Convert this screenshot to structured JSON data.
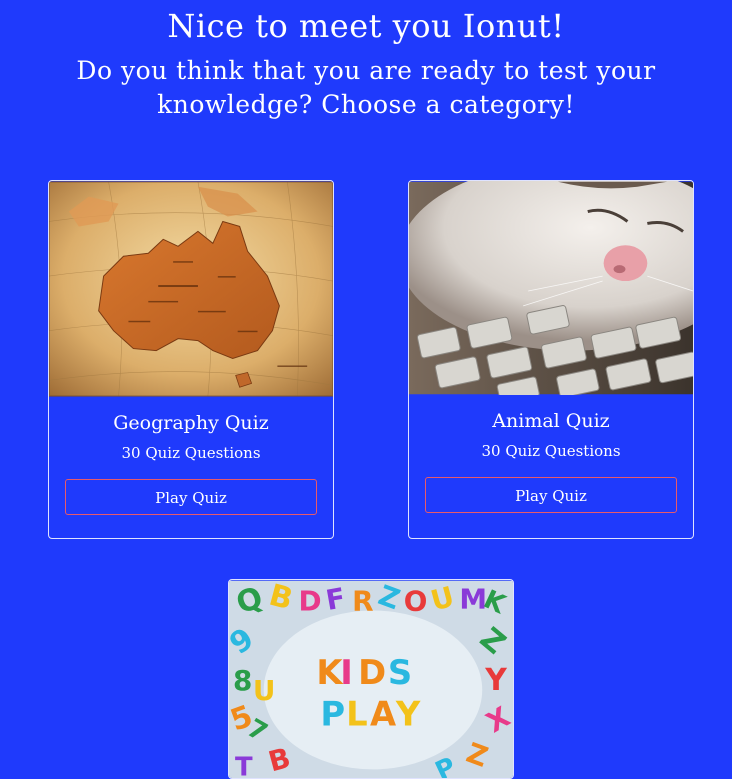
{
  "header": {
    "greeting": "Nice to meet you Ionut!",
    "prompt": "Do you think that you are ready to test your knowledge? Choose a category!"
  },
  "cards": [
    {
      "title": "Geography Quiz",
      "subtitle": "30 Quiz Questions",
      "button": "Play Quiz",
      "image": "australia-globe-photo"
    },
    {
      "title": "Animal Quiz",
      "subtitle": "30 Quiz Questions",
      "button": "Play Quiz",
      "image": "cat-on-keyboard-photo"
    },
    {
      "image": "kids-play-magnetic-letters-photo",
      "image_text": "KIDS PLAY"
    }
  ],
  "colors": {
    "background": "#1f3afc",
    "text": "#ffffff",
    "button_border": "#e85a6a"
  }
}
